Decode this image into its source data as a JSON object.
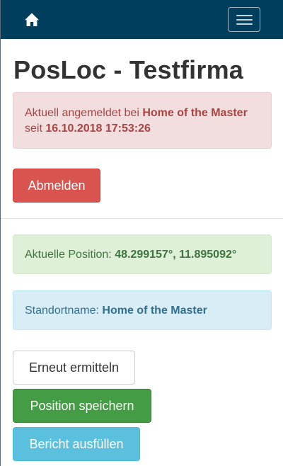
{
  "navbar": {
    "home_icon": "home-icon",
    "menu_icon": "hamburger-menu-icon",
    "background": "#003e5e"
  },
  "page": {
    "title": "PosLoc - Testfirma"
  },
  "login_alert": {
    "prefix": "Aktuell angemeldet bei ",
    "location": "Home of the Master",
    "since_label": " seit ",
    "since_value": "16.10.2018 17:53:26"
  },
  "logout_button": {
    "label": "Abmelden"
  },
  "position_alert": {
    "label": "Aktuelle Position: ",
    "value": "48.299157°, 11.895092°"
  },
  "location_alert": {
    "label": "Standortname: ",
    "value": "Home of the Master"
  },
  "actions": {
    "redetect_label": "Erneut ermitteln",
    "save_position_label": "Position speichern",
    "fill_report_label": "Bericht ausfüllen"
  },
  "colors": {
    "danger": "#d9534f",
    "success": "#449d44",
    "info": "#5bc0de"
  }
}
